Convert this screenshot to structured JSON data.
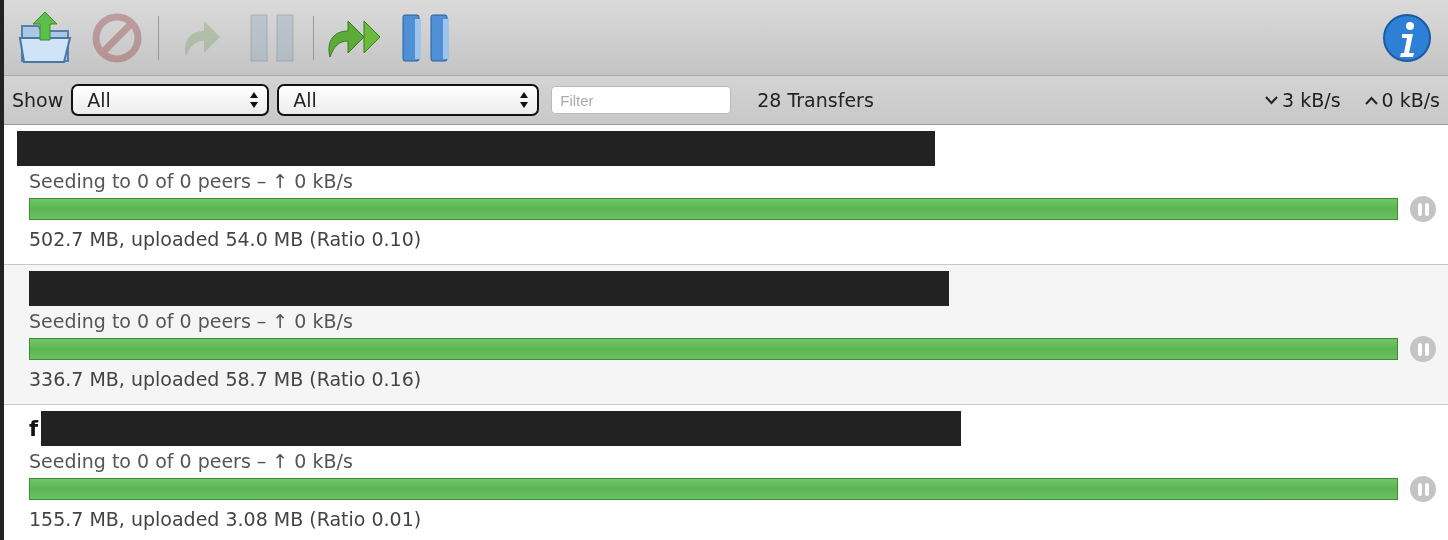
{
  "toolbar": {
    "buttons": [
      {
        "kind": "open",
        "disabled": false
      },
      {
        "kind": "remove",
        "disabled": true
      },
      {
        "kind": "separator"
      },
      {
        "kind": "resume",
        "disabled": true
      },
      {
        "kind": "pause",
        "disabled": true
      },
      {
        "kind": "separator"
      },
      {
        "kind": "resume_all",
        "disabled": false
      },
      {
        "kind": "pause_all",
        "disabled": false
      },
      {
        "kind": "info",
        "disabled": false
      }
    ]
  },
  "filter_bar": {
    "show_label": "Show",
    "dropdowns": [
      {
        "value": "All"
      },
      {
        "value": "All"
      }
    ],
    "search": {
      "placeholder": "Filter"
    },
    "count": "28 Transfers",
    "download_speed": "3 kB/s",
    "upload_speed": "0 kB/s"
  },
  "transfers": [
    {
      "redacted": true,
      "status": "Seeding to 0 of 0 peers – ↑ 0 kB/s",
      "level": 1,
      "progress": "502.7 MB, uploaded 54.0 MB (Ratio 0.10)"
    },
    {
      "redacted": true,
      "status": "Seeding to 0 of 0 peers – ↑ 0 kB/s",
      "level": 1,
      "progress": "336.7 MB, uploaded 58.7 MB (Ratio 0.16)"
    },
    {
      "name": "f",
      "redacted": true,
      "status": "Seeding to 0 of 0 peers – ↑ 0 kB/s",
      "level": 1,
      "progress": "155.7 MB, uploaded 3.08 MB (Ratio 0.01)"
    }
  ]
}
